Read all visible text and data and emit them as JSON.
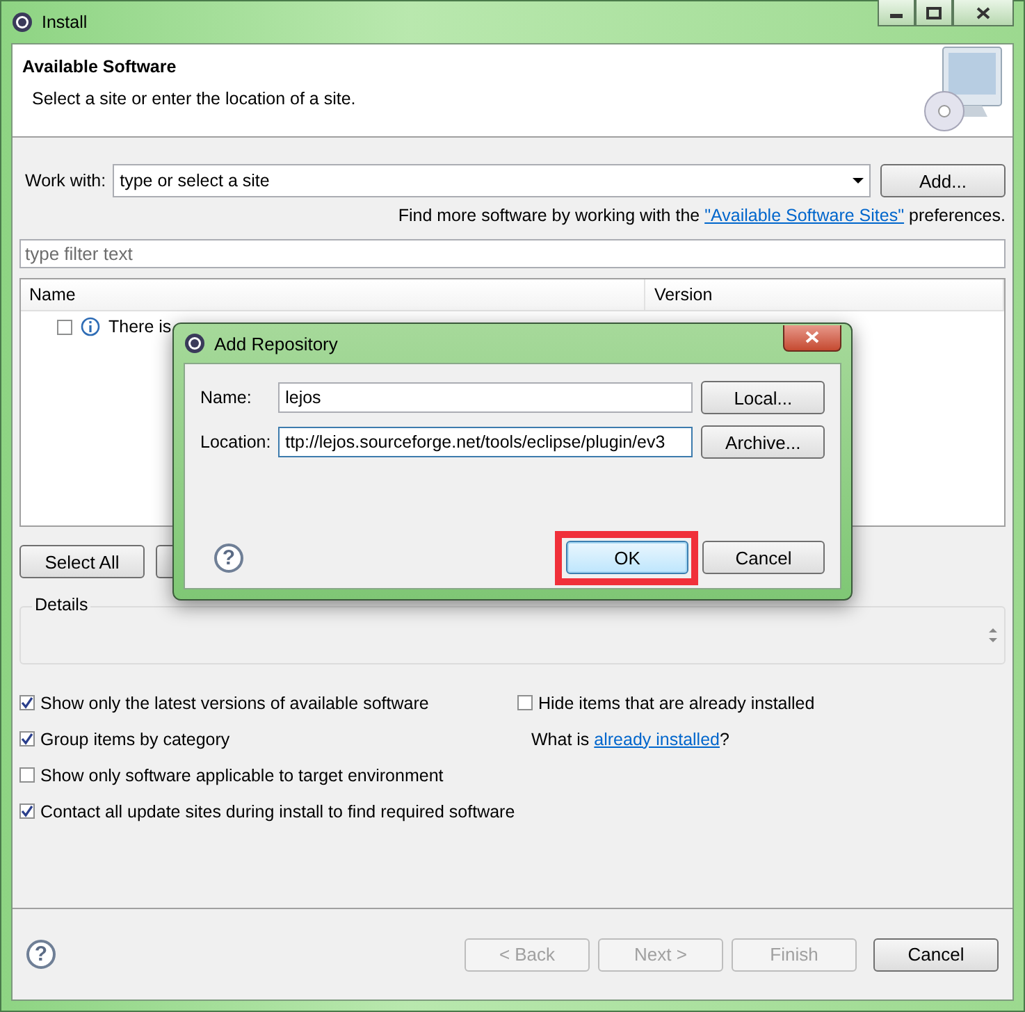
{
  "window": {
    "title": "Install"
  },
  "header": {
    "title": "Available Software",
    "description": "Select a site or enter the location of a site."
  },
  "work_with": {
    "label": "Work with:",
    "value": "type or select a site",
    "button": "Add..."
  },
  "sites_note": {
    "before": "Find more software by working with the ",
    "link": "\"Available Software Sites\"",
    "after": " preferences."
  },
  "filter": {
    "placeholder": "type filter text"
  },
  "table": {
    "columns": [
      "Name",
      "Version"
    ],
    "rows": [
      {
        "checked": false,
        "text": "There is"
      }
    ]
  },
  "table_buttons": [
    "Select All"
  ],
  "details": {
    "label": "Details"
  },
  "options_left": [
    {
      "label": "Show only the latest versions of available software",
      "checked": true
    },
    {
      "label": "Group items by category",
      "checked": true
    },
    {
      "label": "Show only software applicable to target environment",
      "checked": false
    },
    {
      "label": "Contact all update sites during install to find required software",
      "checked": true
    }
  ],
  "options_right": [
    {
      "label": "Hide items that are already installed",
      "checked": false
    }
  ],
  "installed_note": {
    "before": "What is ",
    "link": "already installed",
    "after": "?"
  },
  "help_icon": "?",
  "wizard_buttons": [
    {
      "label": "< Back",
      "disabled": true
    },
    {
      "label": "Next >",
      "disabled": true
    },
    {
      "label": "Finish",
      "disabled": true
    },
    {
      "label": "Cancel",
      "disabled": false
    }
  ],
  "dialog": {
    "title": "Add Repository",
    "help_icon": "?",
    "fields": [
      {
        "label": "Name:",
        "value": "lejos",
        "button": "Local..."
      },
      {
        "label": "Location:",
        "value": "ttp://lejos.sourceforge.net/tools/eclipse/plugin/ev3",
        "button": "Archive..."
      }
    ],
    "buttons": [
      {
        "label": "OK",
        "default": true,
        "highlighted": true
      },
      {
        "label": "Cancel",
        "default": false,
        "highlighted": false
      }
    ]
  }
}
